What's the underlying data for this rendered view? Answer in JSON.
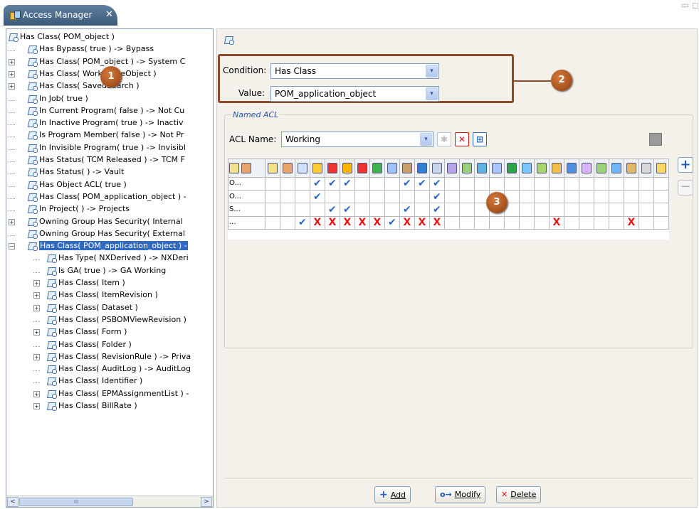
{
  "tab": {
    "title": "Access Manager",
    "close": "✕"
  },
  "window_controls": "▭ ◻",
  "tree": {
    "nodes": [
      {
        "label": "Has Class( POM_object )",
        "exp": "",
        "level": 0
      },
      {
        "label": "Has Bypass( true ) -> Bypass",
        "exp": "",
        "level": 1
      },
      {
        "label": "Has Class( POM_object ) -> System C",
        "exp": "+",
        "level": 1
      },
      {
        "label": "Has Class( WorkspaceObject )",
        "exp": "+",
        "level": 1
      },
      {
        "label": "Has Class( SavedSearch )",
        "exp": "+",
        "level": 1
      },
      {
        "label": "In Job( true )",
        "exp": "",
        "level": 1
      },
      {
        "label": "In Current Program( false ) -> Not Cu",
        "exp": "",
        "level": 1
      },
      {
        "label": "In Inactive Program( true ) -> Inactiv",
        "exp": "",
        "level": 1
      },
      {
        "label": "Is Program Member( false ) -> Not Pr",
        "exp": "",
        "level": 1
      },
      {
        "label": "In Invisible Program( true ) -> Invisibl",
        "exp": "",
        "level": 1
      },
      {
        "label": "Has Status( TCM Released ) -> TCM F",
        "exp": "",
        "level": 1
      },
      {
        "label": "Has Status( ) -> Vault",
        "exp": "",
        "level": 1
      },
      {
        "label": "Has Object ACL( true )",
        "exp": "",
        "level": 1
      },
      {
        "label": "Has Class( POM_application_object ) -",
        "exp": "",
        "level": 1
      },
      {
        "label": "In Project( ) -> Projects",
        "exp": "",
        "level": 1
      },
      {
        "label": "Owning Group Has Security( Internal",
        "exp": "+",
        "level": 1
      },
      {
        "label": "Owning Group Has Security( External",
        "exp": "",
        "level": 1
      },
      {
        "label": "Has Class( POM_application_object ) -",
        "exp": "−",
        "level": 1,
        "selected": true
      },
      {
        "label": "Has Type( NXDerived ) -> NXDeri",
        "exp": "",
        "level": 2
      },
      {
        "label": "Is GA( true ) -> GA Working",
        "exp": "",
        "level": 2
      },
      {
        "label": "Has Class( Item )",
        "exp": "+",
        "level": 2
      },
      {
        "label": "Has Class( ItemRevision )",
        "exp": "+",
        "level": 2
      },
      {
        "label": "Has Class( Dataset )",
        "exp": "+",
        "level": 2
      },
      {
        "label": "Has Class( PSBOMViewRevision )",
        "exp": "",
        "level": 2
      },
      {
        "label": "Has Class( Form )",
        "exp": "+",
        "level": 2
      },
      {
        "label": "Has Class( Folder )",
        "exp": "",
        "level": 2
      },
      {
        "label": "Has Class( RevisionRule ) -> Priva",
        "exp": "+",
        "level": 2
      },
      {
        "label": "Has Class( AuditLog ) -> AuditLog",
        "exp": "",
        "level": 2
      },
      {
        "label": "Has Class( Identifier )",
        "exp": "",
        "level": 2
      },
      {
        "label": "Has Class( EPMAssignmentList ) -",
        "exp": "+",
        "level": 2
      },
      {
        "label": "Has Class( BillRate )",
        "exp": "+",
        "level": 2
      }
    ]
  },
  "scroll": {
    "left": "<",
    "right": ">",
    "thumb": "III"
  },
  "form": {
    "condition_label": "Condition:",
    "condition_value": "Has Class",
    "value_label": "Value:",
    "value_value": "POM_application_object",
    "dd": "▾"
  },
  "named_acl": {
    "legend": "Named ACL",
    "acl_name_label": "ACL Name:",
    "acl_name_value": "Working",
    "star": "✱",
    "remove": "✕",
    "add_btn": "⊞"
  },
  "acl_grid": {
    "header_colors": [
      "#f4e28a",
      "#e8a36b",
      "#cfe0ff",
      "#ffcc33",
      "#e33",
      "#ffb400",
      "#e33",
      "#3fb14d",
      "#9ec3ff",
      "#c9a06b",
      "#2f7fd6",
      "#c7d4ea",
      "#b6a6e8",
      "#9ad07b",
      "#5fb3e0",
      "#a8c7ff",
      "#2fa34b",
      "#7ac8ff",
      "#a6d56d",
      "#f2c04a",
      "#4f8fe0",
      "#d8b3ff",
      "#9ed27a",
      "#6fb5ff",
      "#e0b76b",
      "#d7d7d7",
      "#ffd966"
    ],
    "rows": [
      {
        "label": "O...",
        "cells": [
          "",
          "",
          "",
          "✓",
          "✓",
          "✓",
          "",
          "",
          "",
          "✓",
          "✓",
          "✓",
          "",
          "",
          "",
          "",
          "",
          "",
          "",
          "",
          "",
          "",
          "",
          "",
          "",
          "",
          ""
        ]
      },
      {
        "label": "O...",
        "cells": [
          "",
          "",
          "",
          "✓",
          "",
          "",
          "",
          "",
          "",
          "",
          "",
          "✓",
          "",
          "",
          "",
          "",
          "",
          "",
          "",
          "",
          "",
          "",
          "",
          "",
          "",
          "",
          ""
        ]
      },
      {
        "label": "S...",
        "cells": [
          "",
          "",
          "",
          "",
          "✓",
          "✓",
          "",
          "",
          "",
          "✓",
          "",
          "✓",
          "",
          "",
          "",
          "",
          "",
          "",
          "",
          "",
          "",
          "",
          "",
          "",
          "",
          "",
          ""
        ]
      },
      {
        "label": "...",
        "cells": [
          "",
          "",
          "✓",
          "✗",
          "✗",
          "✗",
          "✗",
          "✗",
          "✓",
          "✗",
          "✗",
          "✗",
          "",
          "",
          "",
          "",
          "",
          "",
          "",
          "✗",
          "",
          "",
          "",
          "",
          "✗",
          "",
          ""
        ]
      }
    ]
  },
  "side": {
    "plus": "+",
    "minus": "−"
  },
  "badges": {
    "one": "1",
    "two": "2",
    "three": "3"
  },
  "buttons": {
    "add_icon": "+",
    "add": "Add",
    "modify_icon": "o→",
    "modify": "Modify",
    "delete_icon": "✕",
    "delete": "Delete"
  },
  "accent": "#316ac5",
  "callout_color": "#8b4b2c"
}
